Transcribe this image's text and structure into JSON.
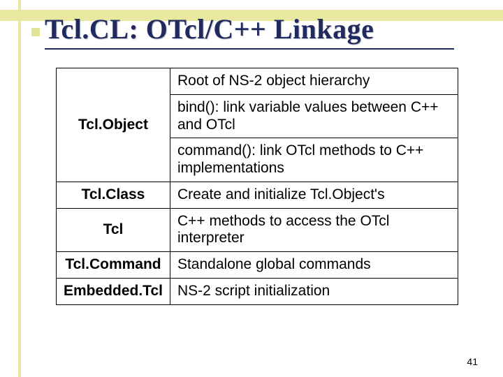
{
  "title": "Tcl.CL: OTcl/C++ Linkage",
  "table": {
    "rows": [
      {
        "label": "",
        "desc": "Root of NS-2 object hierarchy"
      },
      {
        "label": "Tcl.Object",
        "desc": "bind(): link variable values between C++ and OTcl"
      },
      {
        "label": "",
        "desc": "command(): link OTcl methods to C++ implementations"
      },
      {
        "label": "Tcl.Class",
        "desc": "Create and initialize Tcl.Object's"
      },
      {
        "label": "Tcl",
        "desc": "C++ methods to access the OTcl interpreter"
      },
      {
        "label": "Tcl.Command",
        "desc": "Standalone global commands"
      },
      {
        "label": "Embedded.Tcl",
        "desc": "NS-2 script initialization"
      }
    ]
  },
  "page_number": "41"
}
